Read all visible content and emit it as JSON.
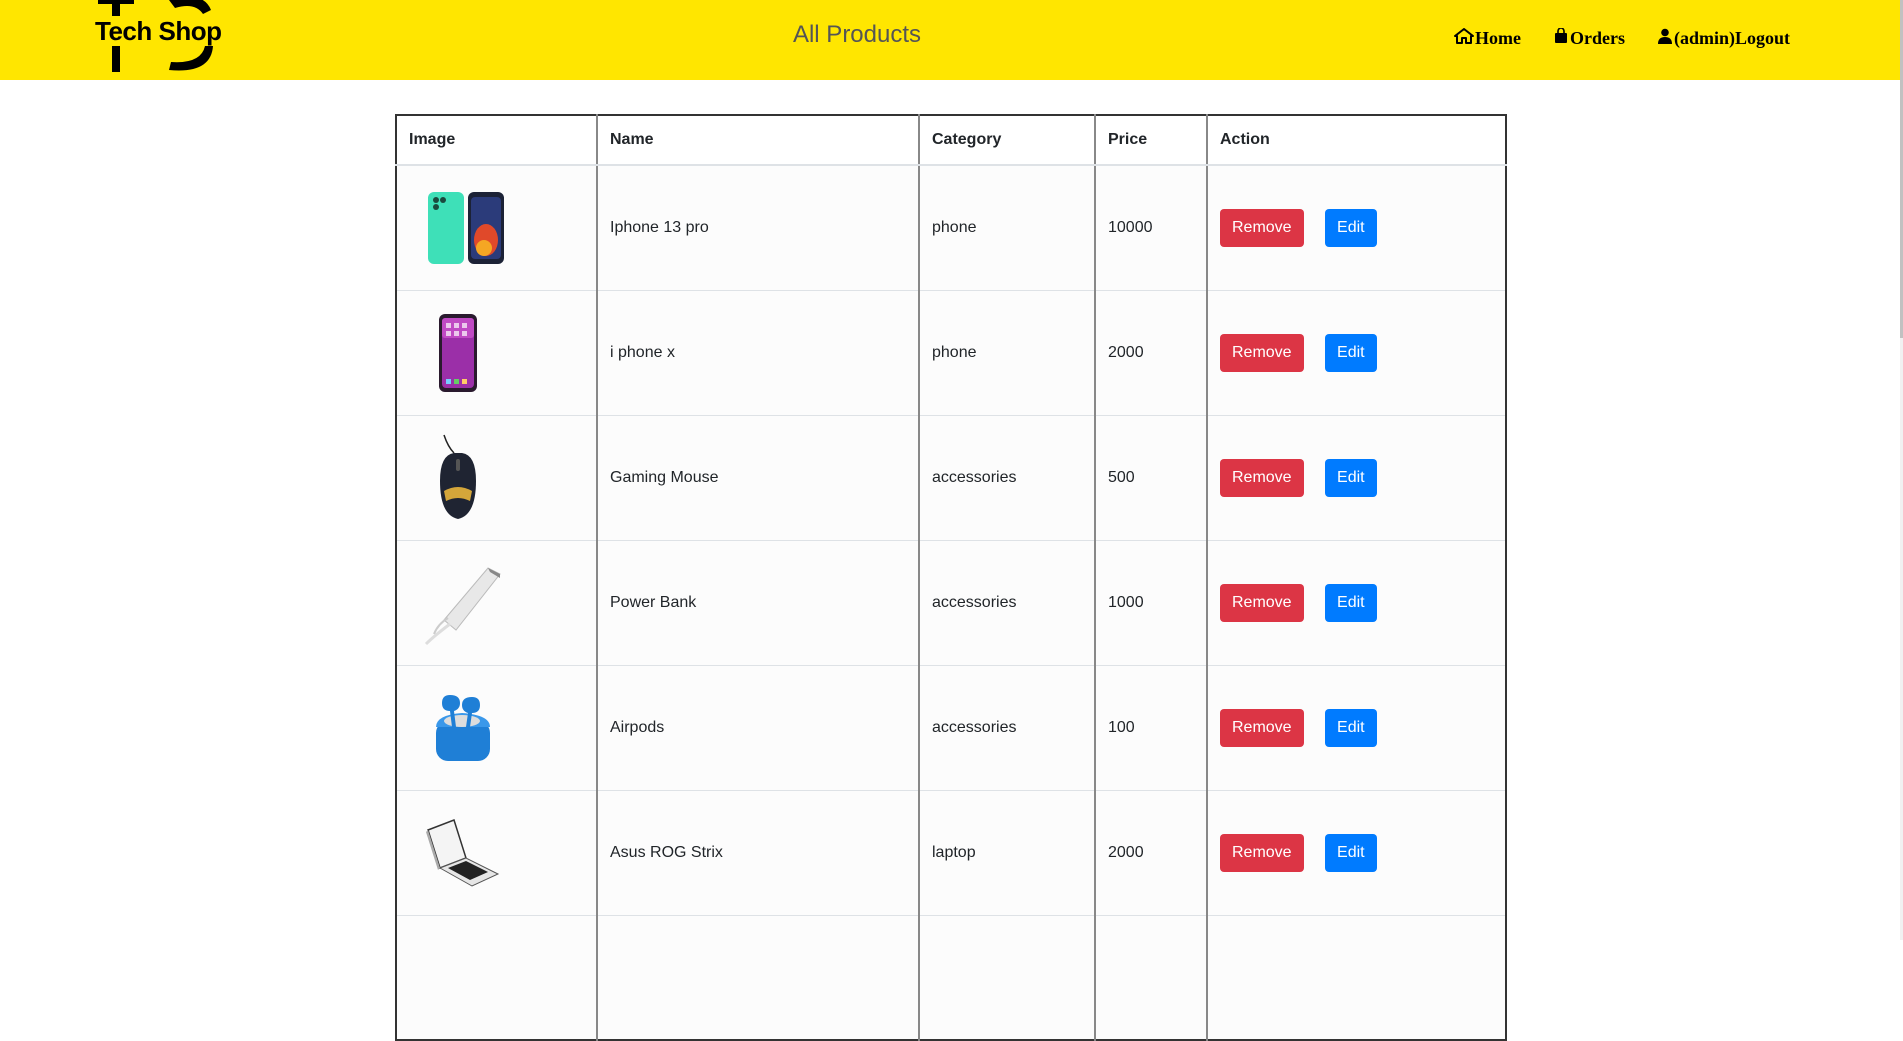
{
  "header": {
    "logo_text": "Tech Shop",
    "page_title": "All Products",
    "nav": [
      {
        "label": "Home",
        "icon": "home-icon"
      },
      {
        "label": "Orders",
        "icon": "shopping-bag-icon"
      },
      {
        "label": "(admin)Logout",
        "icon": "user-icon"
      }
    ],
    "bg_color": "#ffe600"
  },
  "table": {
    "columns": [
      "Image",
      "Name",
      "Category",
      "Price",
      "Action"
    ],
    "rows": [
      {
        "name": "Iphone 13 pro",
        "category": "phone",
        "price": "10000",
        "image": "phone-pair-image"
      },
      {
        "name": "i phone x",
        "category": "phone",
        "price": "2000",
        "image": "phone-image"
      },
      {
        "name": "Gaming Mouse",
        "category": "accessories",
        "price": "500",
        "image": "mouse-image"
      },
      {
        "name": "Power Bank",
        "category": "accessories",
        "price": "1000",
        "image": "power-bank-image"
      },
      {
        "name": "Airpods",
        "category": "accessories",
        "price": "100",
        "image": "airpods-image"
      },
      {
        "name": "Asus ROG Strix",
        "category": "laptop",
        "price": "2000",
        "image": "laptop-image"
      }
    ],
    "remove_label": "Remove",
    "edit_label": "Edit",
    "remove_color": "#dc3545",
    "edit_color": "#007bff"
  }
}
